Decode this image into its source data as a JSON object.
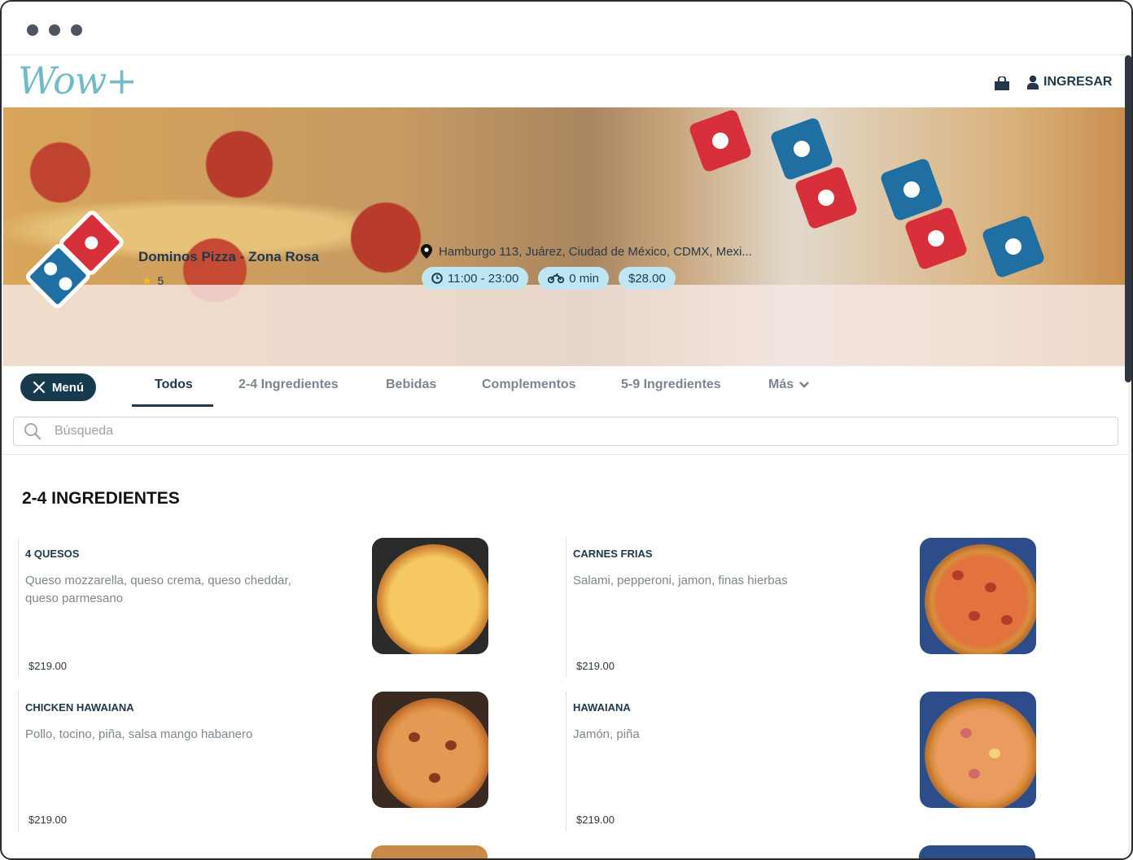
{
  "browser": {
    "dots": [
      "dot",
      "dot",
      "dot"
    ]
  },
  "brand": {
    "logo_text": "Wow+"
  },
  "header": {
    "login_label": "INGRESAR",
    "bag_icon": "shopping-bag-icon",
    "user_icon": "user-icon"
  },
  "store": {
    "name": "Dominos Pizza - Zona Rosa",
    "rating": "5",
    "address": "Hamburgo 113, Juárez, Ciudad de México, CDMX, Mexi...",
    "hours": "11:00 - 23:00",
    "delivery_time": "0 min",
    "min_order": "$28.00"
  },
  "nav": {
    "menu_label": "Menú",
    "tabs": [
      {
        "label": "Todos",
        "active": true
      },
      {
        "label": "2-4 Ingredientes"
      },
      {
        "label": "Bebidas"
      },
      {
        "label": "Complementos"
      },
      {
        "label": "5-9 Ingredientes"
      },
      {
        "label": "Más"
      }
    ]
  },
  "search": {
    "placeholder": "Búsqueda"
  },
  "section": {
    "title": "2-4 INGREDIENTES"
  },
  "products": [
    {
      "name": "4 QUESOS",
      "description": "Queso mozzarella, queso crema, queso cheddar, queso parmesano",
      "price": "$219.00"
    },
    {
      "name": "CARNES FRIAS",
      "description": "Salami, pepperoni, jamon, finas hierbas",
      "price": "$219.00"
    },
    {
      "name": "CHICKEN HAWAIANA",
      "description": "Pollo, tocino, piña, salsa mango habanero",
      "price": "$219.00"
    },
    {
      "name": "HAWAIANA",
      "description": "Jamón, piña",
      "price": "$219.00"
    }
  ],
  "colors": {
    "primary_dark": "#183a4e",
    "chip_bg": "#bfe7f3",
    "domino_blue": "#1f6fa3",
    "domino_red": "#d8303a",
    "logo_teal": "#6fbcc8"
  }
}
